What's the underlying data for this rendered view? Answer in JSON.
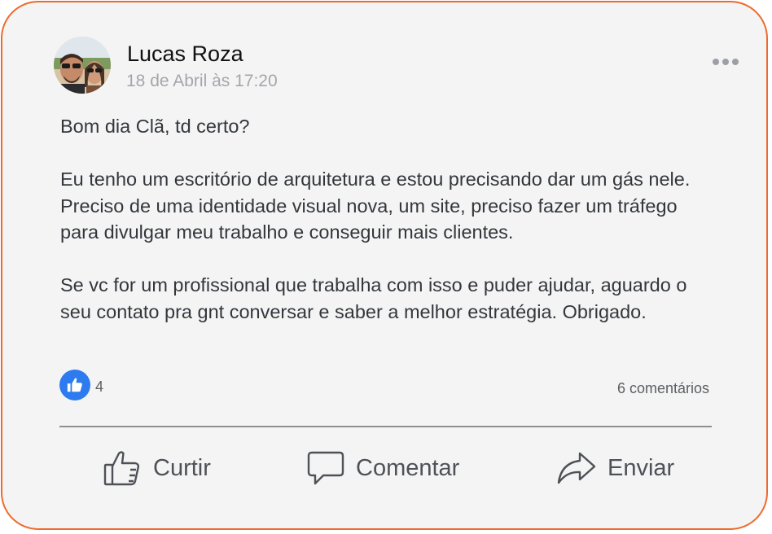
{
  "post": {
    "author": "Lucas Roza",
    "timestamp": "18 de Abril às 17:20",
    "paragraphs": [
      "Bom dia Clã, td certo?",
      "Eu tenho um escritório de arquitetura e estou precisando dar um gás nele. Preciso de uma identidade visual nova, um site, preciso fazer um tráfego para divulgar meu trabalho e conseguir mais clientes.",
      "Se vc for um profissional que trabalha com isso e puder ajudar, aguardo o seu contato pra gnt conversar e saber a melhor estratégia. Obrigado."
    ],
    "like_count": "4",
    "comments_label": "6 comentários"
  },
  "actions": {
    "like_label": "Curtir",
    "comment_label": "Comentar",
    "share_label": "Enviar"
  },
  "icons": {
    "more": "more-options-icon",
    "reaction": "thumbs-up-icon",
    "like": "thumbs-up-outline-icon",
    "comment": "speech-bubble-icon",
    "share": "share-arrow-icon"
  },
  "colors": {
    "card_border": "#ee6a2c",
    "card_background": "#f4f4f5",
    "like_badge": "#2d7bef",
    "text": "#33373b",
    "muted_text": "#a4a6aa"
  }
}
